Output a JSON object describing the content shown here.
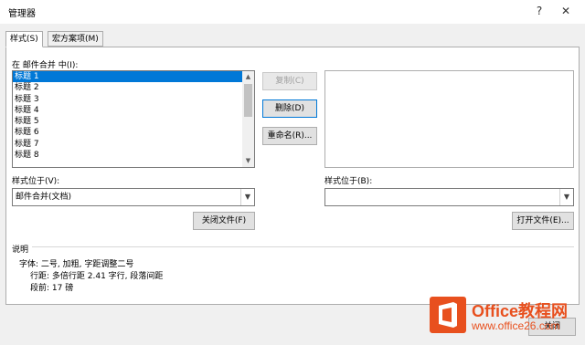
{
  "window": {
    "title": "管理器",
    "help_icon": "?",
    "close_icon": "✕"
  },
  "tabs": [
    {
      "label": "样式(S)"
    },
    {
      "label": "宏方案项(M)"
    }
  ],
  "left": {
    "in_label": "在 邮件合并 中(I):",
    "items": [
      "标题 1",
      "标题 2",
      "标题 3",
      "标题 4",
      "标题 5",
      "标题 6",
      "标题 7",
      "标题 8"
    ],
    "selected_index": 0,
    "location_label": "样式位于(V):",
    "location_value": "邮件合并(文档)",
    "close_file_button": "关闭文件(F)"
  },
  "middle": {
    "copy_button": "复制(C)",
    "delete_button": "删除(D)",
    "rename_button": "重命名(R)..."
  },
  "right": {
    "location_label": "样式位于(B):",
    "location_value": "",
    "open_file_button": "打开文件(E)..."
  },
  "description": {
    "heading": "说明",
    "lines": [
      "字体: 二号, 加粗, 字距调整二号",
      "行距: 多倍行距 2.41 字行, 段落间距",
      "段前: 17 磅"
    ]
  },
  "footer": {
    "close_button": "关闭"
  },
  "watermark": {
    "title": "Office教程网",
    "url": "www.office26.com",
    "brand_color": "#e8501e"
  }
}
